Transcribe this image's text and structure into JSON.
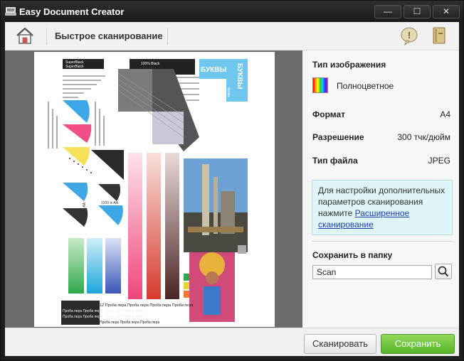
{
  "window": {
    "title": "Easy Document Creator",
    "min_glyph": "—",
    "max_glyph": "☐",
    "close_glyph": "✕"
  },
  "toolbar": {
    "title": "Быстрое сканирование",
    "help_glyph": "!"
  },
  "preview": {
    "labels": {
      "superblack1": "SuperBlack",
      "superblack2": "SuperBlack",
      "black100": "100% Black",
      "letters_h": "БУКВЫ",
      "letters_v": "БУКВЫ",
      "letters_v_small": "буквы",
      "ruler1": "1200 w AA",
      "ruler2": "1200 w AA",
      "pen_row1": "12 Проба пера Проба пера Проба пера Проба пера",
      "pen_row2": "Проба пера Проба пера Проба пера Проба пера",
      "pen_row3": "Проба пера Проба пера Проба пера Проба пера",
      "pen_row4": "Проба пера Проба пера Проба пера"
    }
  },
  "panel": {
    "image_type_label": "Тип изображения",
    "image_type_value": "Полноцветное",
    "format_label": "Формат",
    "format_value": "A4",
    "resolution_label": "Разрешение",
    "resolution_value": "300 тчк/дюйм",
    "filetype_label": "Тип файла",
    "filetype_value": "JPEG",
    "info_text": "Для настройки дополнительных параметров сканирования нажмите ",
    "info_link": "Расширенное сканирование",
    "save_folder_label": "Сохранить в папку",
    "save_folder_value": "Scan"
  },
  "buttons": {
    "scan": "Сканировать",
    "save": "Сохранить"
  },
  "colors": {
    "save_green": "#58b42b",
    "info_bg": "#dff5f7",
    "link": "#1a3fb0"
  }
}
